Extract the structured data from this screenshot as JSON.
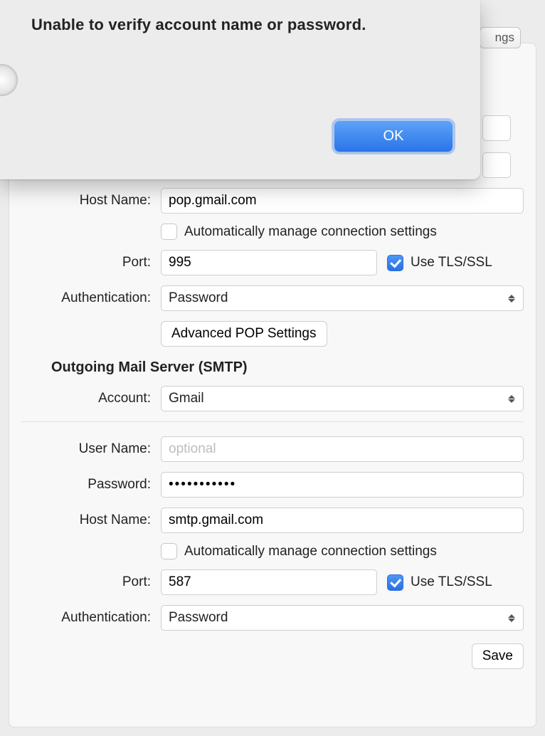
{
  "sheet": {
    "title": "Unable to verify account name or password.",
    "ok": "OK"
  },
  "tab_fragment": "ngs",
  "incoming": {
    "host_label": "Host Name:",
    "host_value": "pop.gmail.com",
    "auto_label": "Automatically manage connection settings",
    "auto_checked": false,
    "port_label": "Port:",
    "port_value": "995",
    "tls_label": "Use TLS/SSL",
    "tls_checked": true,
    "auth_label": "Authentication:",
    "auth_value": "Password",
    "advanced": "Advanced POP Settings"
  },
  "smtp_title": "Outgoing Mail Server (SMTP)",
  "smtp": {
    "account_label": "Account:",
    "account_value": "Gmail",
    "user_label": "User Name:",
    "user_value": "",
    "user_placeholder": "optional",
    "password_label": "Password:",
    "password_value": "•••••••••••",
    "host_label": "Host Name:",
    "host_value": "smtp.gmail.com",
    "auto_label": "Automatically manage connection settings",
    "auto_checked": false,
    "port_label": "Port:",
    "port_value": "587",
    "tls_label": "Use TLS/SSL",
    "tls_checked": true,
    "auth_label": "Authentication:",
    "auth_value": "Password"
  },
  "save_label": "Save"
}
